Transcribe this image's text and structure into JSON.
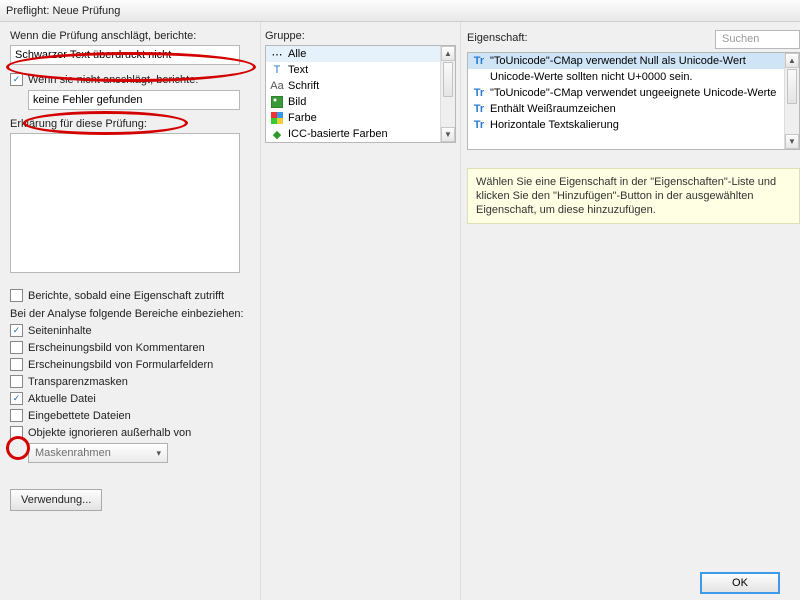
{
  "window": {
    "title": "Preflight: Neue Prüfung"
  },
  "left": {
    "hit_label": "Wenn die Prüfung anschlägt, berichte:",
    "hit_value": "Schwarzer Text überdruckt nicht",
    "nohit_check_label": "Wenn sie nicht anschlägt, berichte:",
    "nohit_value": "keine Fehler gefunden",
    "explain_label": "Erklärung für diese Prüfung:",
    "report_once": "Berichte, sobald eine Eigenschaft zutrifft",
    "include_label": "Bei der Analyse folgende Bereiche einbeziehen:",
    "opts": [
      {
        "label": "Seiteninhalte",
        "checked": true
      },
      {
        "label": "Erscheinungsbild von Kommentaren",
        "checked": false
      },
      {
        "label": "Erscheinungsbild von Formularfeldern",
        "checked": false
      },
      {
        "label": "Transparenzmasken",
        "checked": false
      },
      {
        "label": "Aktuelle Datei",
        "checked": true
      },
      {
        "label": "Eingebettete Dateien",
        "checked": false
      },
      {
        "label": "Objekte ignorieren außerhalb von",
        "checked": false
      }
    ],
    "dropdown": "Maskenrahmen",
    "usage_btn": "Verwendung..."
  },
  "group": {
    "label": "Gruppe:",
    "items": [
      "Alle",
      "Text",
      "Schrift",
      "Bild",
      "Farbe",
      "ICC-basierte Farben"
    ]
  },
  "props": {
    "label": "Eigenschaft:",
    "search_placeholder": "Suchen",
    "items": [
      {
        "t": "\"ToUnicode\"-CMap verwendet Null als Unicode-Wert",
        "sel": true
      },
      {
        "t": "Unicode-Werte sollten nicht U+0000 sein.",
        "sub": true
      },
      {
        "t": "\"ToUnicode\"-CMap verwendet ungeeignete Unicode-Werte"
      },
      {
        "t": "Enthält Weißraumzeichen"
      },
      {
        "t": "Horizontale Textskalierung"
      }
    ],
    "hint": "Wählen Sie eine Eigenschaft in der \"Eigenschaften\"-Liste und klicken Sie den \"Hinzufügen\"-Button in der ausgewählten Eigenschaft, um diese hinzuzufügen."
  },
  "ok": "OK"
}
